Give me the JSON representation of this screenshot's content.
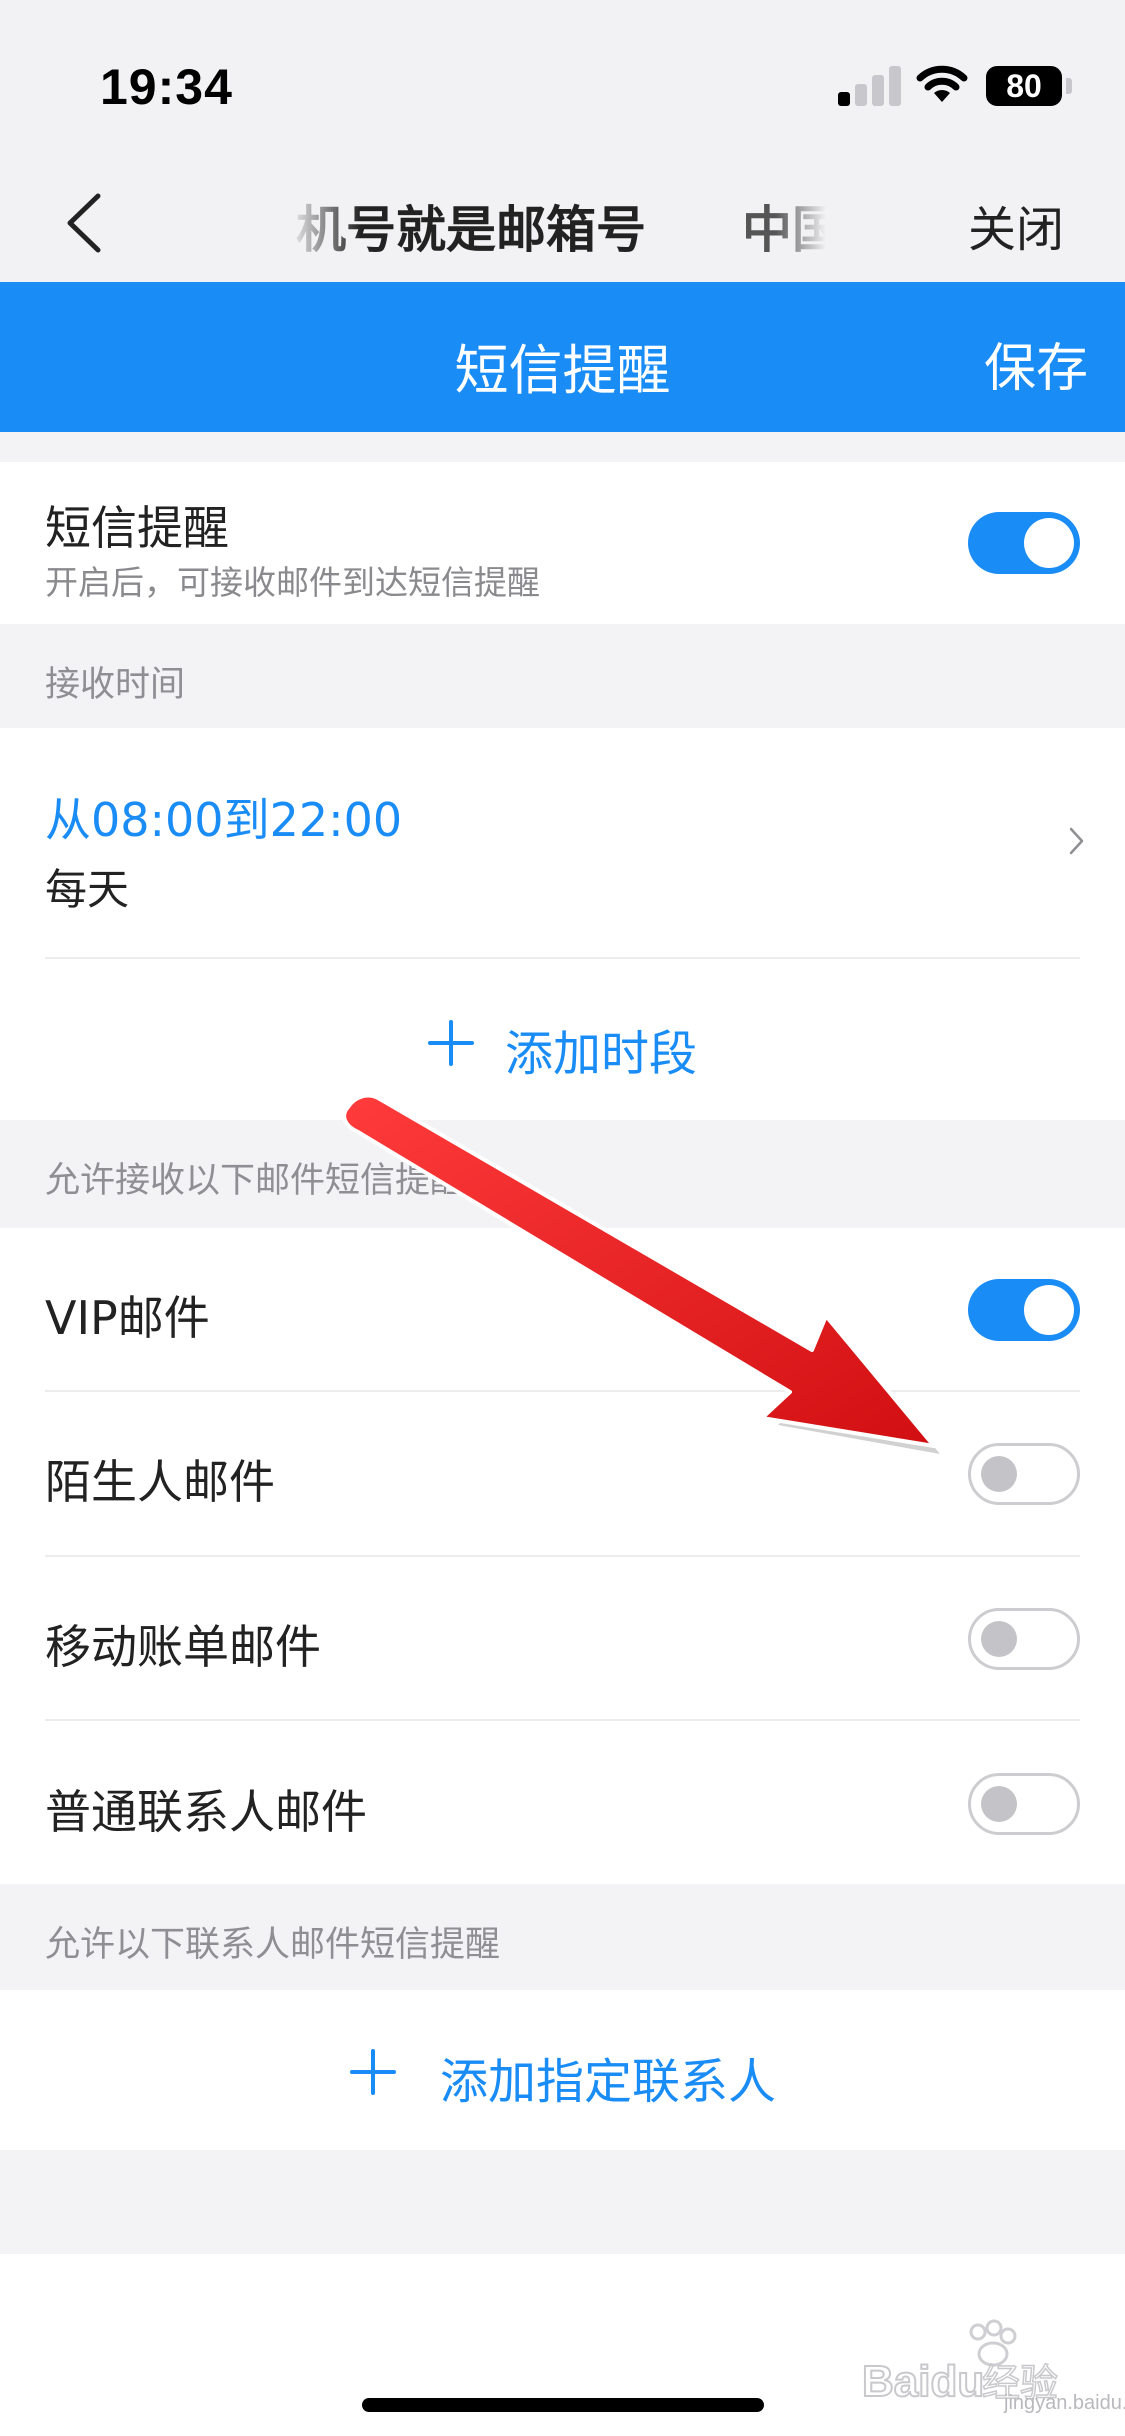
{
  "status_bar": {
    "time": "19:34",
    "battery": "80"
  },
  "nav": {
    "title": "机号就是邮箱号",
    "title_next": "中国",
    "close_label": "关闭"
  },
  "header": {
    "title": "短信提醒",
    "save_label": "保存"
  },
  "sms_reminder": {
    "label": "短信提醒",
    "description": "开启后，可接收邮件到达短信提醒",
    "enabled": true
  },
  "receive_time": {
    "header": "接收时间",
    "range": "从08:00到22:00",
    "repeat": "每天",
    "add_period_label": "添加时段"
  },
  "allow_mail": {
    "header": "允许接收以下邮件短信提醒",
    "items": [
      {
        "label": "VIP邮件",
        "enabled": true
      },
      {
        "label": "陌生人邮件",
        "enabled": false
      },
      {
        "label": "移动账单邮件",
        "enabled": false
      },
      {
        "label": "普通联系人邮件",
        "enabled": false
      }
    ]
  },
  "allow_contacts": {
    "header": "允许以下联系人邮件短信提醒",
    "add_contact_label": "添加指定联系人"
  },
  "watermark": {
    "brand": "Baidu经验",
    "url": "jingyan.baidu.com"
  },
  "colors": {
    "accent": "#1a8cf5",
    "background": "#f3f3f5",
    "annotation_arrow": "#e8171b"
  },
  "icons": {
    "back": "chevron-left-icon",
    "forward": "chevron-right-icon",
    "add": "plus-icon"
  }
}
